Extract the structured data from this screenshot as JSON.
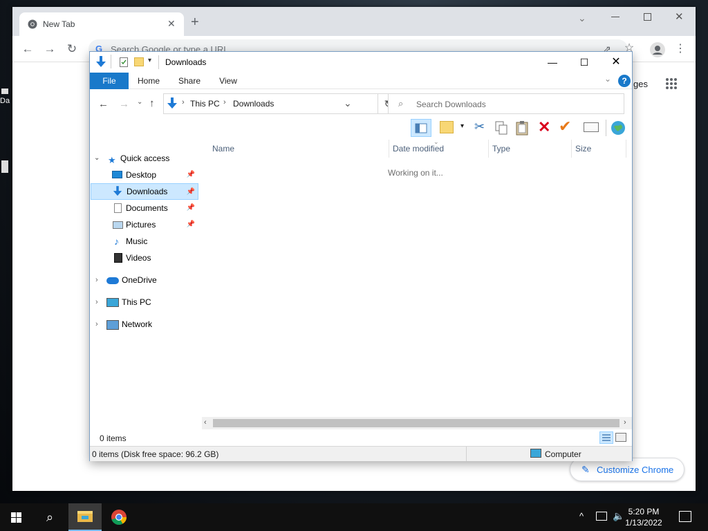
{
  "desktop": {
    "fragment_label": "Da"
  },
  "chrome": {
    "tab_title": "New Tab",
    "new_tab_symbol": "+",
    "omnibox_placeholder": "Search Google or type a URL",
    "images_link_fragment": "ges",
    "customize_label": "Customize Chrome"
  },
  "explorer": {
    "window_title": "Downloads",
    "ribbon_tabs": [
      "File",
      "Home",
      "Share",
      "View"
    ],
    "breadcrumb": [
      "This PC",
      "Downloads"
    ],
    "search_placeholder": "Search Downloads",
    "nav": {
      "quick_access": "Quick access",
      "quick_items": [
        "Desktop",
        "Downloads",
        "Documents",
        "Pictures",
        "Music",
        "Videos"
      ],
      "selected": "Downloads",
      "onedrive": "OneDrive",
      "this_pc": "This PC",
      "network": "Network"
    },
    "columns": [
      "Name",
      "Date modified",
      "Type",
      "Size"
    ],
    "loading_text": "Working on it...",
    "items_count": "0 items",
    "status_text": "0 items (Disk free space: 96.2 GB)",
    "status_location": "Computer"
  },
  "taskbar": {
    "time": "5:20 PM",
    "date": "1/13/2022"
  },
  "colors": {
    "ribbon_file_tab": "#1979ca",
    "selection": "#cce8ff",
    "chrome_link": "#1a73e8",
    "delete_icon": "#d9001b",
    "check_icon": "#e87a1a"
  }
}
